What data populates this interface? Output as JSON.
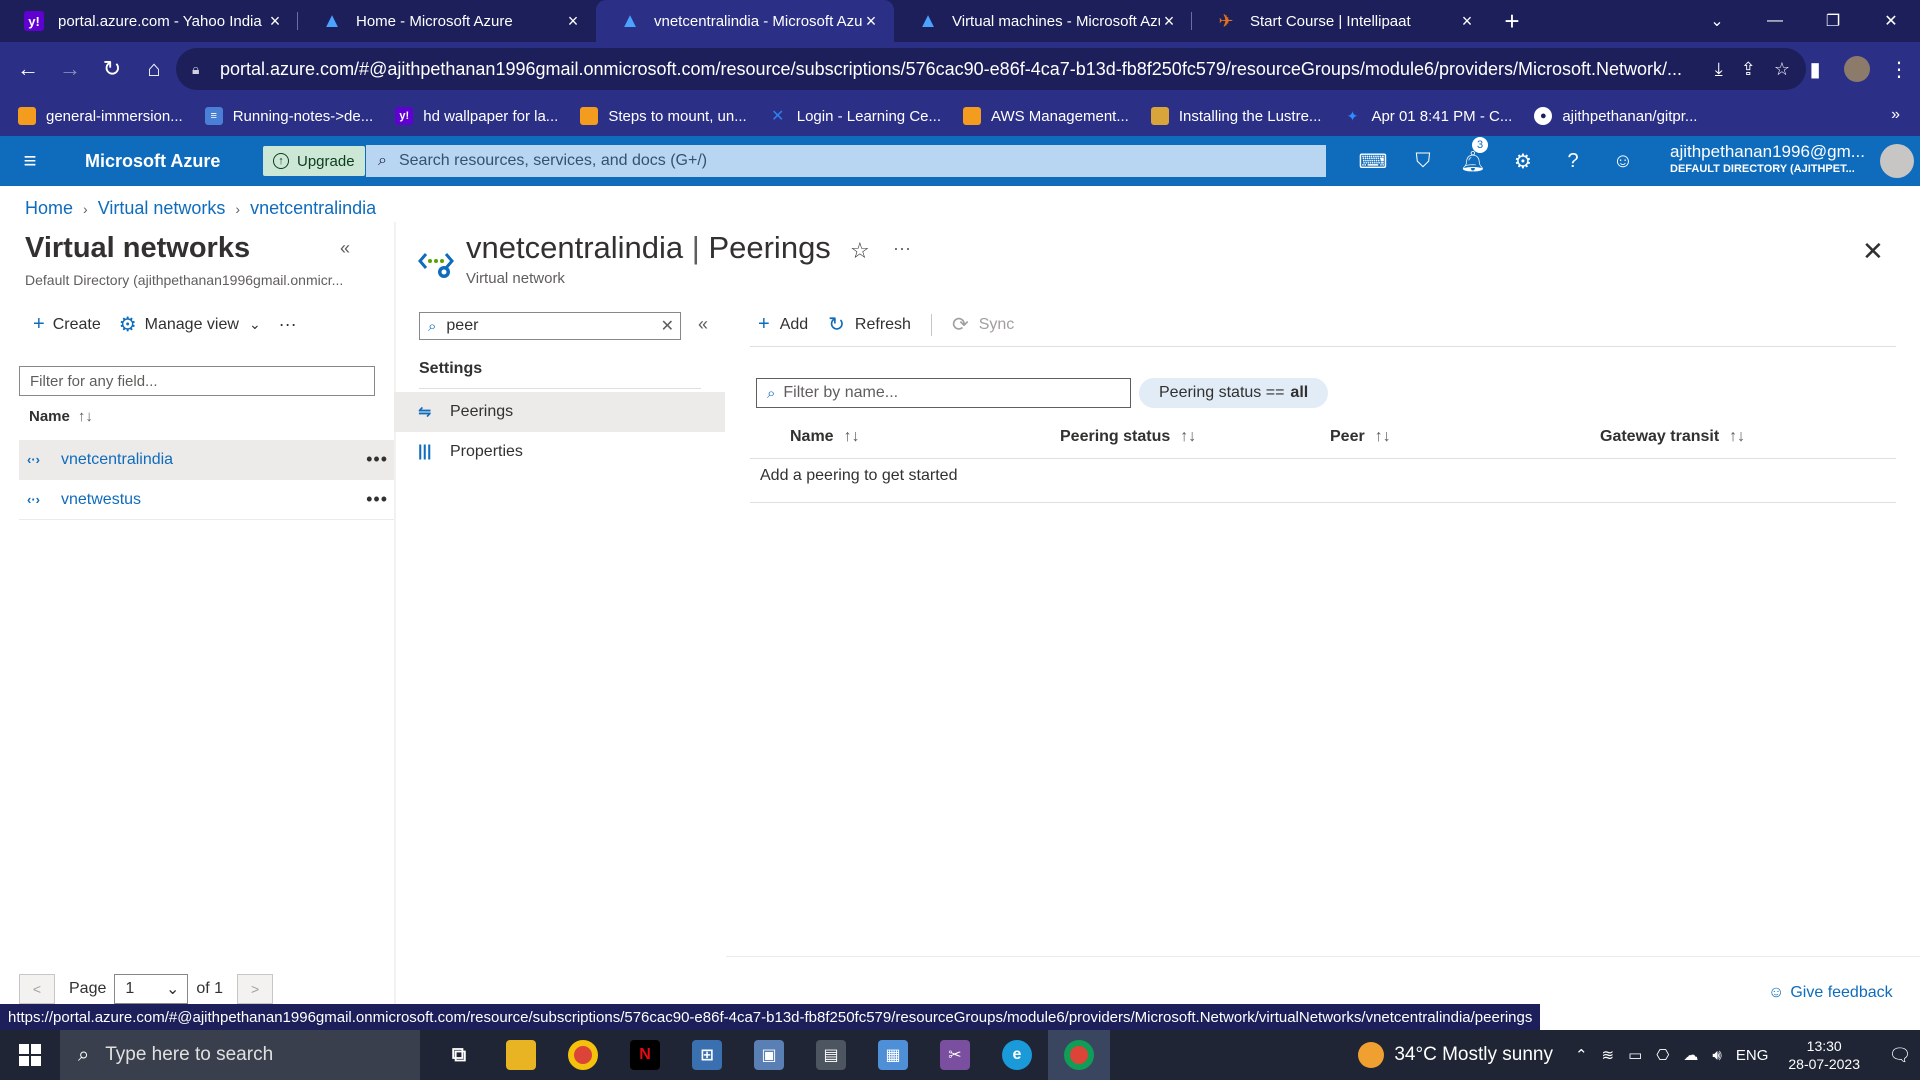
{
  "browser": {
    "tabs": [
      {
        "title": "portal.azure.com - Yahoo India Se",
        "icon": "yahoo-icon",
        "color": "#6001d2"
      },
      {
        "title": "Home - Microsoft Azure",
        "icon": "azure-icon",
        "color": "#0f6cbd"
      },
      {
        "title": "vnetcentralindia - Microsoft Azure",
        "icon": "azure-icon",
        "color": "#0f6cbd"
      },
      {
        "title": "Virtual machines - Microsoft Azure",
        "icon": "azure-icon",
        "color": "#0f6cbd"
      },
      {
        "title": "Start Course | Intellipaat",
        "icon": "intellipaat-icon",
        "color": "#e8701a"
      }
    ],
    "url": "portal.azure.com/#@ajithpethanan1996gmail.onmicrosoft.com/resource/subscriptions/576cac90-e86f-4ca7-b13d-fb8f250fc579/resourceGroups/module6/providers/Microsoft.Network/...",
    "bookmarks": [
      {
        "label": "general-immersion...",
        "icon": "aws-icon",
        "color": "#f39c1e"
      },
      {
        "label": "Running-notes->de...",
        "icon": "doc-icon",
        "color": "#4a7fd6"
      },
      {
        "label": "hd wallpaper for la...",
        "icon": "yahoo-icon",
        "color": "#6001d2"
      },
      {
        "label": "Steps to mount, un...",
        "icon": "aws-icon",
        "color": "#f39c1e"
      },
      {
        "label": "Login - Learning Ce...",
        "icon": "x-icon",
        "color": "#2f80ed"
      },
      {
        "label": "AWS Management...",
        "icon": "aws-icon",
        "color": "#f39c1e"
      },
      {
        "label": "Installing the Lustre...",
        "icon": "box-icon",
        "color": "#d9a53b"
      },
      {
        "label": "Apr 01 8:41 PM - C...",
        "icon": "zoom-icon",
        "color": "#2d8cff"
      },
      {
        "label": "ajithpethanan/gitpr...",
        "icon": "github-icon",
        "color": "#ffffff"
      }
    ],
    "status_url": "https://portal.azure.com/#@ajithpethanan1996gmail.onmicrosoft.com/resource/subscriptions/576cac90-e86f-4ca7-b13d-fb8f250fc579/resourceGroups/module6/providers/Microsoft.Network/virtualNetworks/vnetcentralindia/peerings"
  },
  "azure": {
    "brand": "Microsoft Azure",
    "upgrade": "Upgrade",
    "search_placeholder": "Search resources, services, and docs (G+/)",
    "notification_count": "3",
    "user_name": "ajithpethanan1996@gm...",
    "user_directory": "DEFAULT DIRECTORY (AJITHPET...",
    "breadcrumb": [
      "Home",
      "Virtual networks",
      "vnetcentralindia"
    ]
  },
  "left_blade": {
    "title": "Virtual networks",
    "subtitle": "Default Directory (ajithpethanan1996gmail.onmicr...",
    "create": "Create",
    "manage_view": "Manage view",
    "filter_placeholder": "Filter for any field...",
    "column_name": "Name",
    "rows": [
      "vnetcentralindia",
      "vnetwestus"
    ],
    "page_label": "Page",
    "page_value": "1",
    "page_of": "of 1"
  },
  "resource": {
    "name": "vnetcentralindia",
    "section": "Peerings",
    "title_sep": "|",
    "type": "Virtual network"
  },
  "menu": {
    "search_value": "peer",
    "group": "Settings",
    "items": [
      {
        "label": "Peerings",
        "icon": "peerings-icon"
      },
      {
        "label": "Properties",
        "icon": "properties-icon"
      }
    ]
  },
  "content": {
    "add": "Add",
    "refresh": "Refresh",
    "sync": "Sync",
    "filter_placeholder": "Filter by name...",
    "pill_label": "Peering status ==",
    "pill_value": "all",
    "columns": [
      "Name",
      "Peering status",
      "Peer",
      "Gateway transit"
    ],
    "empty_message": "Add a peering to get started",
    "feedback": "Give feedback"
  },
  "taskbar": {
    "search_placeholder": "Type here to search",
    "weather": "34°C  Mostly sunny",
    "language": "ENG",
    "time": "13:30",
    "date": "28-07-2023",
    "apps": [
      {
        "name": "task-view-icon",
        "glyph": "⧉",
        "color": "#1f2535"
      },
      {
        "name": "file-explorer-icon",
        "glyph": "▬",
        "color": "#e8b424"
      },
      {
        "name": "chrome-icon",
        "glyph": "◉",
        "color": "#db4437"
      },
      {
        "name": "netflix-icon",
        "glyph": "N",
        "color": "#000000"
      },
      {
        "name": "network-app-icon",
        "glyph": "⊞",
        "color": "#3a6fb0"
      },
      {
        "name": "remote-desktop-icon",
        "glyph": "▣",
        "color": "#5a7fb5"
      },
      {
        "name": "vm-app-icon",
        "glyph": "▤",
        "color": "#4c5560"
      },
      {
        "name": "store-icon",
        "glyph": "▦",
        "color": "#4f8fd8"
      },
      {
        "name": "snipping-icon",
        "glyph": "✂",
        "color": "#7a4fa0"
      },
      {
        "name": "edge-icon",
        "glyph": "e",
        "color": "#1a9ad9"
      },
      {
        "name": "chrome-profile-icon",
        "glyph": "◉",
        "color": "#db4437"
      }
    ]
  }
}
